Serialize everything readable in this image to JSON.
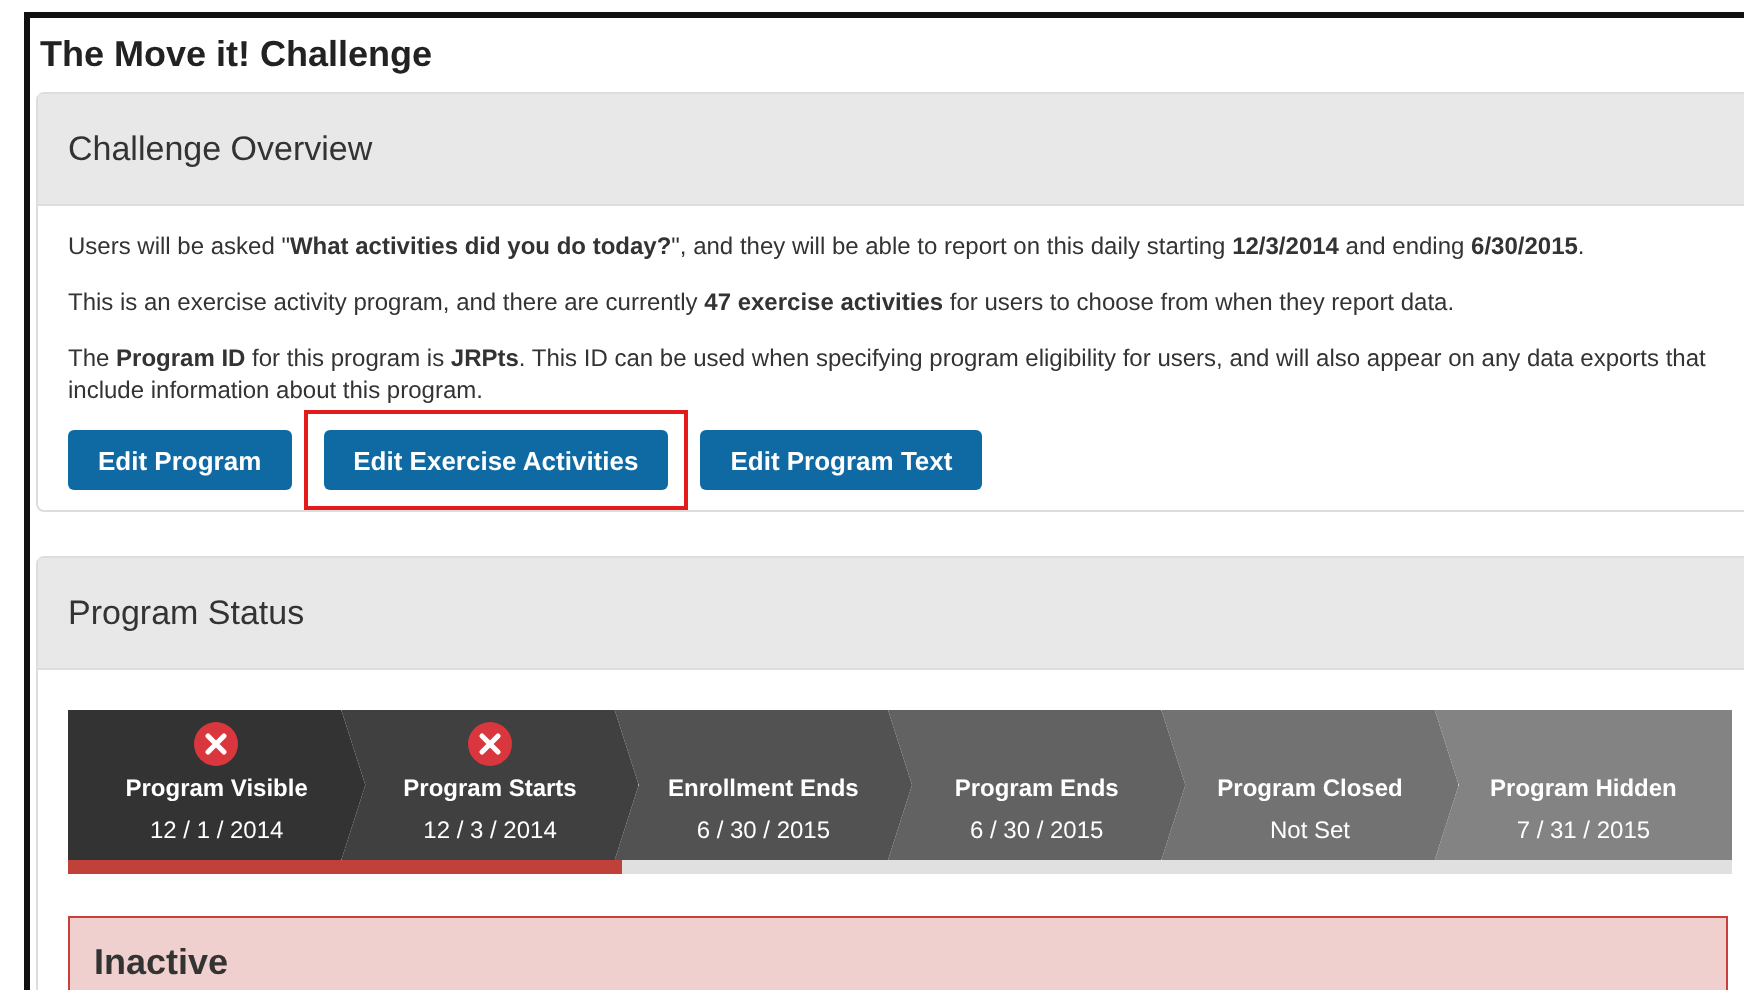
{
  "title": "The Move it! Challenge",
  "overview": {
    "heading": "Challenge Overview",
    "paragraphs": [
      "Users will be asked \"**What activities did you do today?**\", and they will be able to report on this daily starting **12/3/2014** and ending **6/30/2015**.",
      "This is an exercise activity program, and there are currently **47 exercise activities** for users to choose from when they report data.",
      "The **Program ID** for this program is **JRPts**. This ID can be used when specifying program eligibility for users, and will also appear on any data exports that include information about this program."
    ],
    "buttons": [
      {
        "label": "Edit Program",
        "highlighted": false
      },
      {
        "label": "Edit Exercise Activities",
        "highlighted": true
      },
      {
        "label": "Edit Program Text",
        "highlighted": false
      }
    ]
  },
  "status": {
    "heading": "Program Status",
    "steps": [
      {
        "label": "Program Visible",
        "date": "12 / 1 / 2014",
        "flagged": true
      },
      {
        "label": "Program Starts",
        "date": "12 / 3 / 2014",
        "flagged": true
      },
      {
        "label": "Enrollment Ends",
        "date": "6 / 30 / 2015",
        "flagged": false
      },
      {
        "label": "Program Ends",
        "date": "6 / 30 / 2015",
        "flagged": false
      },
      {
        "label": "Program Closed",
        "date": "Not Set",
        "flagged": false
      },
      {
        "label": "Program Hidden",
        "date": "7 / 31 / 2015",
        "flagged": false
      }
    ],
    "progress": {
      "level": 0.333
    },
    "alert": {
      "title": "Inactive"
    }
  }
}
